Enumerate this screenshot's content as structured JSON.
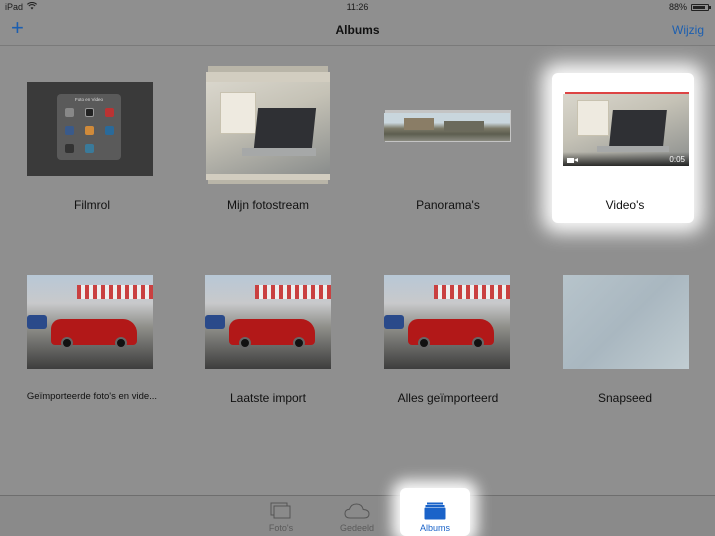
{
  "status_bar": {
    "device": "iPad",
    "time": "11:26",
    "battery": "88%",
    "battery_level": 0.88
  },
  "nav": {
    "add_label": "+",
    "title": "Albums",
    "edit_label": "Wijzig"
  },
  "albums": [
    {
      "label": "Filmrol",
      "thumb_text": "Foto en Video"
    },
    {
      "label": "Mijn fotostream"
    },
    {
      "label": "Panorama's"
    },
    {
      "label": "Video's",
      "duration": "0:05"
    },
    {
      "label": "Geïmporteerde foto's en vide..."
    },
    {
      "label": "Laatste import"
    },
    {
      "label": "Alles geïmporteerd"
    },
    {
      "label": "Snapseed"
    }
  ],
  "tabs": [
    {
      "label": "Foto's",
      "icon": "photos-icon"
    },
    {
      "label": "Gedeeld",
      "icon": "cloud-icon"
    },
    {
      "label": "Albums",
      "icon": "albums-icon",
      "active": true
    }
  ],
  "colors": {
    "accent": "#1a63c9",
    "background": "#8f8f8f"
  }
}
